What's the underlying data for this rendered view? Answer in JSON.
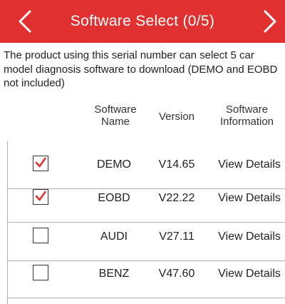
{
  "header": {
    "title": "Software Select (0/5)",
    "accent_color": "#e03030",
    "back_icon": "chevron-left-icon",
    "forward_icon": "chevron-right-icon"
  },
  "description": "The product using this serial number can select 5 car model diagnosis software to download (DEMO and EOBD not included)",
  "columns": {
    "name": "Software Name",
    "version": "Version",
    "info": "Software Information"
  },
  "rows": [
    {
      "checked": true,
      "name": "DEMO",
      "version": "V14.65",
      "info": "View Details"
    },
    {
      "checked": true,
      "name": "EOBD",
      "version": "V22.22",
      "info": "View Details"
    },
    {
      "checked": false,
      "name": "AUDI",
      "version": "V27.11",
      "info": "View Details"
    },
    {
      "checked": false,
      "name": "BENZ",
      "version": "V47.60",
      "info": "View Details"
    }
  ]
}
